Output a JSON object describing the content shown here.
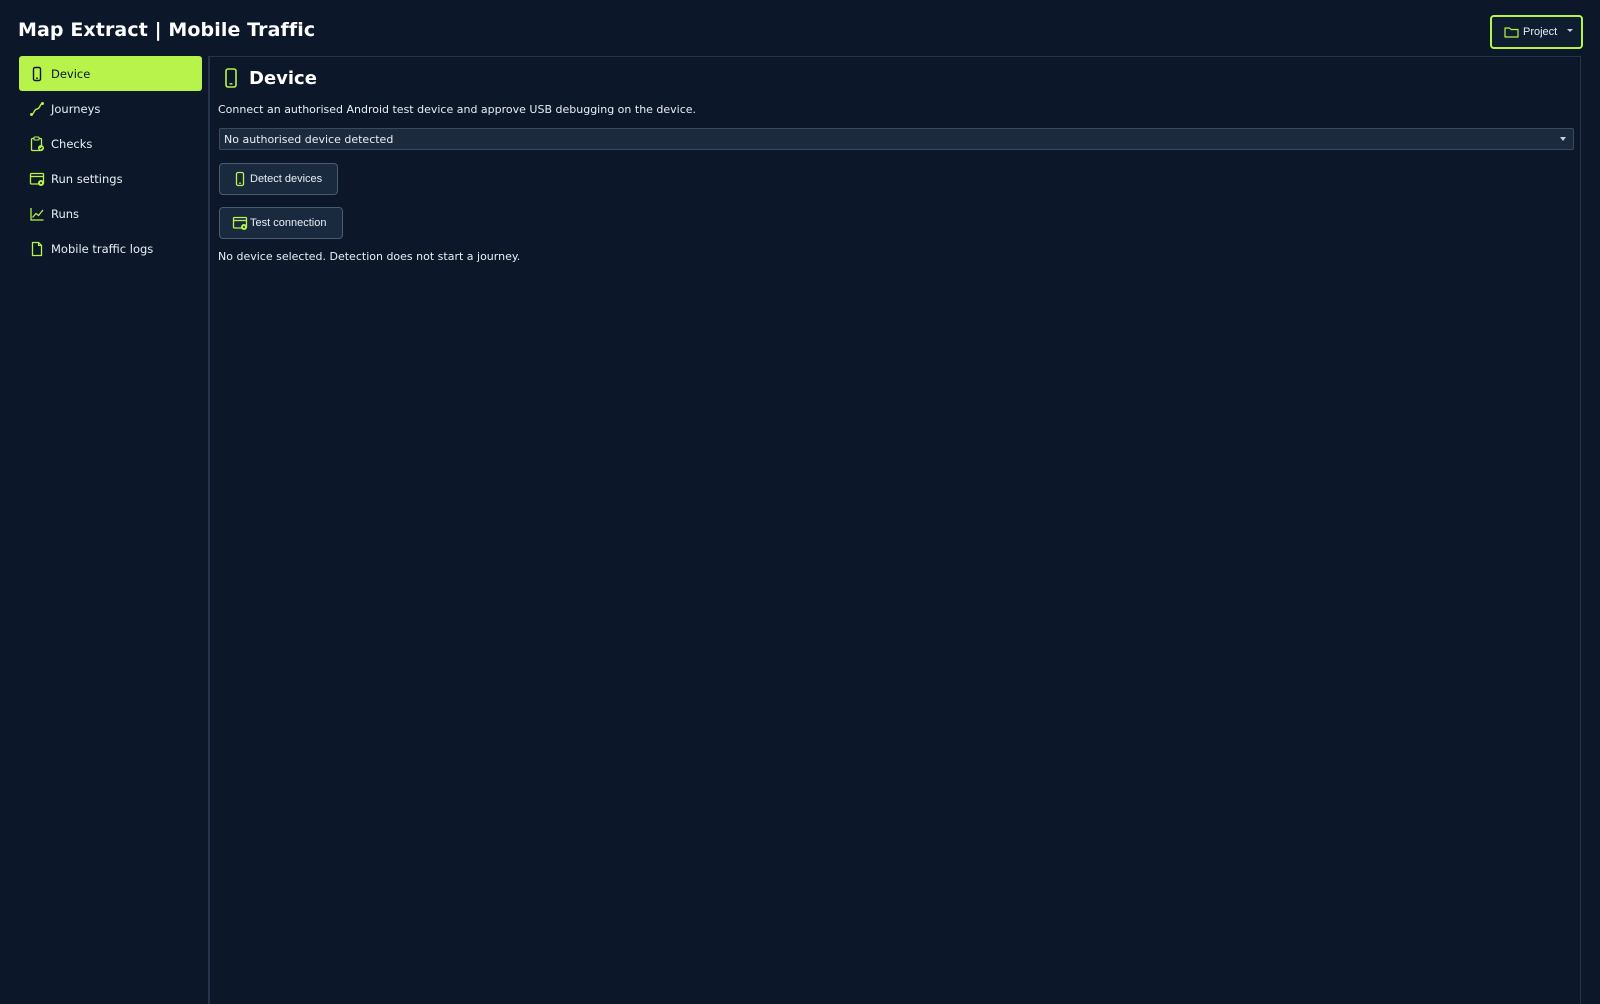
{
  "app": {
    "title": "Map Extract | Mobile Traffic",
    "accent_color": "#b7f34a",
    "background_color": "#0c1829"
  },
  "header": {
    "project_button": {
      "label": "Project",
      "icon": "folder-icon"
    }
  },
  "sidebar": {
    "items": [
      {
        "label": "Device",
        "icon": "phone-icon",
        "active": true
      },
      {
        "label": "Journeys",
        "icon": "route-icon",
        "active": false
      },
      {
        "label": "Checks",
        "icon": "clipboard-check-icon",
        "active": false
      },
      {
        "label": "Run settings",
        "icon": "window-settings-icon",
        "active": false
      },
      {
        "label": "Runs",
        "icon": "line-chart-icon",
        "active": false
      },
      {
        "label": "Mobile traffic logs",
        "icon": "document-icon",
        "active": false
      }
    ]
  },
  "main": {
    "title": "Device",
    "title_icon": "phone-icon",
    "instructions": "Connect an authorised Android test device and approve USB debugging on the device.",
    "device_select": {
      "value": "No authorised device detected"
    },
    "detect_button": {
      "label": "Detect devices",
      "icon": "phone-icon"
    },
    "test_button": {
      "label": "Test connection",
      "icon": "window-settings-icon"
    },
    "status": "No device selected. Detection does not start a journey."
  }
}
